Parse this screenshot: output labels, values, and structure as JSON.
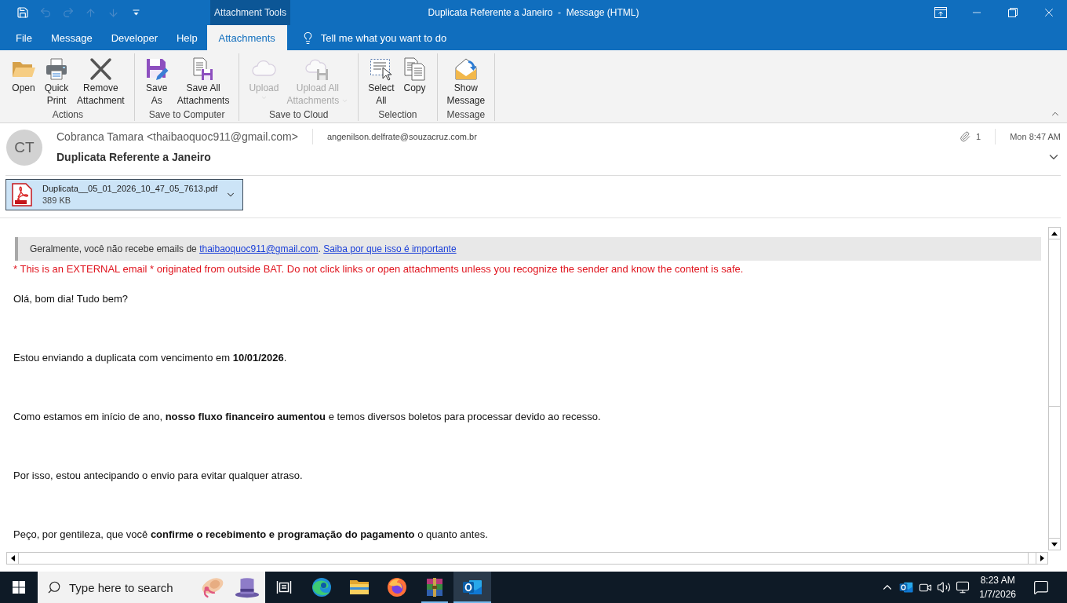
{
  "quick_access": [
    {
      "kind": "save",
      "disabled": false
    },
    {
      "kind": "undo",
      "disabled": true
    },
    {
      "kind": "redo",
      "disabled": true
    },
    {
      "kind": "previous",
      "disabled": true
    },
    {
      "kind": "next",
      "disabled": true
    },
    {
      "kind": "customize",
      "disabled": false
    }
  ],
  "window": {
    "context_group": "Attachment Tools",
    "title": "Duplicata Referente a Janeiro  -  Message (HTML)"
  },
  "tabs": [
    {
      "label": "File",
      "selected": false
    },
    {
      "label": "Message",
      "selected": false
    },
    {
      "label": "Developer",
      "selected": false
    },
    {
      "label": "Help",
      "selected": false
    },
    {
      "label": "Attachments",
      "selected": true
    }
  ],
  "tell_me": "Tell me what you want to do",
  "ribbon": {
    "groups": [
      {
        "label": "Actions",
        "commands": [
          {
            "kind": "open",
            "lines": [
              "Open"
            ],
            "disabled": false,
            "dropdown": false
          },
          {
            "kind": "print",
            "lines": [
              "Quick",
              "Print"
            ],
            "disabled": false,
            "dropdown": false
          },
          {
            "kind": "remove",
            "lines": [
              "Remove",
              "Attachment"
            ],
            "disabled": false,
            "dropdown": false
          }
        ]
      },
      {
        "label": "Save to Computer",
        "commands": [
          {
            "kind": "save-as",
            "lines": [
              "Save",
              "As"
            ],
            "disabled": false,
            "dropdown": false
          },
          {
            "kind": "save-all",
            "lines": [
              "Save All",
              "Attachments"
            ],
            "disabled": false,
            "dropdown": false
          }
        ]
      },
      {
        "label": "Save to Cloud",
        "commands": [
          {
            "kind": "upload",
            "lines": [
              "Upload"
            ],
            "disabled": true,
            "dropdown": true
          },
          {
            "kind": "upload-all",
            "lines": [
              "Upload All",
              "Attachments"
            ],
            "disabled": true,
            "dropdown": true
          }
        ]
      },
      {
        "label": "Selection",
        "commands": [
          {
            "kind": "select-all",
            "lines": [
              "Select",
              "All"
            ],
            "disabled": false,
            "dropdown": false
          },
          {
            "kind": "copy",
            "lines": [
              "Copy"
            ],
            "disabled": false,
            "dropdown": false
          }
        ]
      },
      {
        "label": "Message",
        "commands": [
          {
            "kind": "show-message",
            "lines": [
              "Show",
              "Message"
            ],
            "disabled": false,
            "dropdown": false
          }
        ]
      }
    ]
  },
  "message": {
    "initials": "CT",
    "sender": "Cobranca Tamara <thaibaoquoc911@gmail.com>",
    "recipient": "angenilson.delfrate@souzacruz.com.br",
    "attachment_count": "1",
    "received": "Mon 8:47 AM",
    "subject": "Duplicata Referente a Janeiro"
  },
  "attachments": [
    {
      "name": "Duplicata__05_01_2026_10_47_05_7613.pdf",
      "size": "389 KB",
      "selected": true
    }
  ],
  "body": {
    "notice": [
      {
        "kind": "text",
        "text": "Geralmente, você não recebe emails de "
      },
      {
        "kind": "link",
        "text": "thaibaoquoc911@gmail.com"
      },
      {
        "kind": "text",
        "text": ". "
      },
      {
        "kind": "link",
        "text": "Saiba por que isso é importante"
      }
    ],
    "warning": "* This is an EXTERNAL email * originated from outside BAT. Do not click links or open attachments unless you recognize the sender and know the content is safe.",
    "paragraphs": [
      "Olá, bom dia! Tudo bem?",
      "Estou enviando a duplicata com vencimento em **10/01/2026**.",
      "Como estamos em início de ano, **nosso fluxo financeiro aumentou** e temos diversos boletos para processar devido ao recesso.",
      "Por isso, estou antecipando o envio para evitar qualquer atraso.",
      "Peço, por gentileza, que você **confirme o recebimento e programação do pagamento** o quanto antes."
    ]
  },
  "taskbar": {
    "search_placeholder": "Type here to search",
    "apps": [
      {
        "kind": "task-view",
        "running": false,
        "selected": false
      },
      {
        "kind": "edge",
        "running": false,
        "selected": false
      },
      {
        "kind": "explorer",
        "running": false,
        "selected": false
      },
      {
        "kind": "firefox",
        "running": false,
        "selected": false
      },
      {
        "kind": "winrar",
        "running": true,
        "selected": false
      },
      {
        "kind": "outlook",
        "running": true,
        "selected": true
      }
    ],
    "tray": [
      {
        "kind": "chevron"
      },
      {
        "kind": "outlook"
      },
      {
        "kind": "meet"
      },
      {
        "kind": "volume"
      },
      {
        "kind": "network"
      }
    ],
    "clock": {
      "time": "8:23 AM",
      "date": "1/7/2026"
    }
  }
}
